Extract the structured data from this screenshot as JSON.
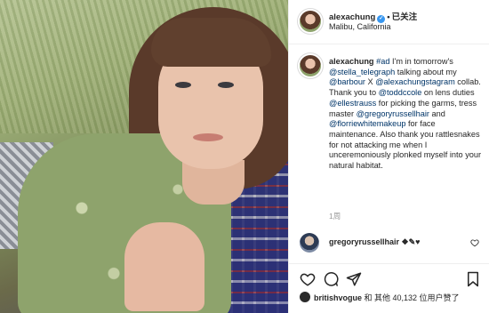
{
  "post": {
    "username": "alexachung",
    "follow_label": "已关注",
    "location": "Malibu, California",
    "verified_glyph": "✓",
    "separator": "•"
  },
  "caption": {
    "username": "alexachung",
    "parts": [
      {
        "t": "#ad",
        "m": true
      },
      {
        "t": " I'm in tomorrow's ",
        "m": false
      },
      {
        "t": "@stella_telegraph",
        "m": true
      },
      {
        "t": " talking about my ",
        "m": false
      },
      {
        "t": "@barbour",
        "m": true
      },
      {
        "t": " X ",
        "m": false
      },
      {
        "t": "@alexachungstagram",
        "m": true
      },
      {
        "t": " collab. Thank you to ",
        "m": false
      },
      {
        "t": "@toddccole",
        "m": true
      },
      {
        "t": " on lens duties ",
        "m": false
      },
      {
        "t": "@ellestrauss",
        "m": true
      },
      {
        "t": " for picking the garms, tress master ",
        "m": false
      },
      {
        "t": "@gregoryrussellhair",
        "m": true
      },
      {
        "t": " and ",
        "m": false
      },
      {
        "t": "@florriewhitemakeup",
        "m": true
      },
      {
        "t": " for face maintenance. Also thank you rattlesnakes for not attacking me when I unceremoniously plonked myself into your natural habitat.",
        "m": false
      }
    ],
    "time": "1周"
  },
  "comment": {
    "username": "gregoryrussellhair",
    "text": "❖✎♥"
  },
  "likes": {
    "username": "britishvogue",
    "text": "和 其他 40,132 位用户赞了"
  },
  "icons": {
    "heart": "heart-icon",
    "comment": "comment-icon",
    "share": "share-icon",
    "bookmark": "bookmark-icon"
  },
  "colors": {
    "link": "#003569",
    "verified": "#3897f0",
    "muted": "#999999"
  }
}
